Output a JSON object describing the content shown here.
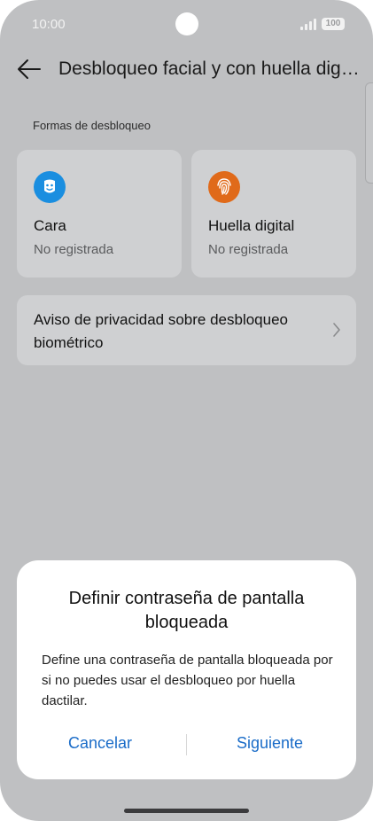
{
  "status_bar": {
    "time": "10:00",
    "battery": "100",
    "icons": [
      "signal-icon",
      "battery-icon"
    ]
  },
  "app_bar": {
    "back_icon": "back-arrow-icon",
    "title": "Desbloqueo facial y con huella digital"
  },
  "section": {
    "label": "Formas de desbloqueo"
  },
  "cards": [
    {
      "icon": "face-icon",
      "icon_color": "#1a8ee0",
      "title": "Cara",
      "status": "No registrada"
    },
    {
      "icon": "fingerprint-icon",
      "icon_color": "#e06a1a",
      "title": "Huella digital",
      "status": "No registrada"
    }
  ],
  "privacy_item": {
    "label": "Aviso de privacidad sobre desbloqueo biométrico",
    "icon": "chevron-right-icon"
  },
  "dialog": {
    "title": "Definir contraseña de pantalla bloqueada",
    "message": "Define una contraseña de pantalla bloqueada por si no puedes usar el desbloqueo por huella dactilar.",
    "cancel_label": "Cancelar",
    "next_label": "Siguiente",
    "accent_color": "#1a6cc8"
  }
}
